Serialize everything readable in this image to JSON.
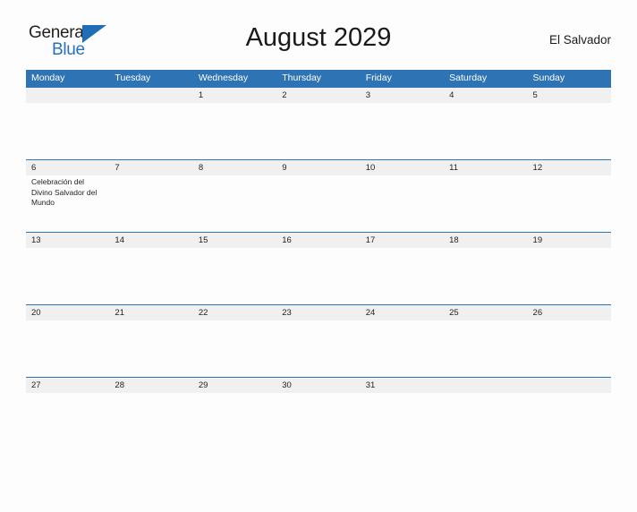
{
  "brand": {
    "word_one": "General",
    "word_two": "Blue",
    "triangle_icon": "blue-triangle-icon",
    "accent_color": "#2572b8"
  },
  "header": {
    "title": "August 2029",
    "region": "El Salvador"
  },
  "theme": {
    "header_bar_color": "#2e74b5",
    "number_band_color": "#f0f0f0",
    "page_background": "#fdfdfd",
    "text_color": "#222222"
  },
  "calendar": {
    "month": "August",
    "year": "2029",
    "weekday_headers": [
      "Monday",
      "Tuesday",
      "Wednesday",
      "Thursday",
      "Friday",
      "Saturday",
      "Sunday"
    ],
    "weeks": [
      {
        "days": [
          {
            "number": "",
            "event": ""
          },
          {
            "number": "",
            "event": ""
          },
          {
            "number": "1",
            "event": ""
          },
          {
            "number": "2",
            "event": ""
          },
          {
            "number": "3",
            "event": ""
          },
          {
            "number": "4",
            "event": ""
          },
          {
            "number": "5",
            "event": ""
          }
        ]
      },
      {
        "days": [
          {
            "number": "6",
            "event": "Celebración del Divino Salvador del Mundo"
          },
          {
            "number": "7",
            "event": ""
          },
          {
            "number": "8",
            "event": ""
          },
          {
            "number": "9",
            "event": ""
          },
          {
            "number": "10",
            "event": ""
          },
          {
            "number": "11",
            "event": ""
          },
          {
            "number": "12",
            "event": ""
          }
        ]
      },
      {
        "days": [
          {
            "number": "13",
            "event": ""
          },
          {
            "number": "14",
            "event": ""
          },
          {
            "number": "15",
            "event": ""
          },
          {
            "number": "16",
            "event": ""
          },
          {
            "number": "17",
            "event": ""
          },
          {
            "number": "18",
            "event": ""
          },
          {
            "number": "19",
            "event": ""
          }
        ]
      },
      {
        "days": [
          {
            "number": "20",
            "event": ""
          },
          {
            "number": "21",
            "event": ""
          },
          {
            "number": "22",
            "event": ""
          },
          {
            "number": "23",
            "event": ""
          },
          {
            "number": "24",
            "event": ""
          },
          {
            "number": "25",
            "event": ""
          },
          {
            "number": "26",
            "event": ""
          }
        ]
      },
      {
        "days": [
          {
            "number": "27",
            "event": ""
          },
          {
            "number": "28",
            "event": ""
          },
          {
            "number": "29",
            "event": ""
          },
          {
            "number": "30",
            "event": ""
          },
          {
            "number": "31",
            "event": ""
          },
          {
            "number": "",
            "event": ""
          },
          {
            "number": "",
            "event": ""
          }
        ]
      }
    ]
  }
}
